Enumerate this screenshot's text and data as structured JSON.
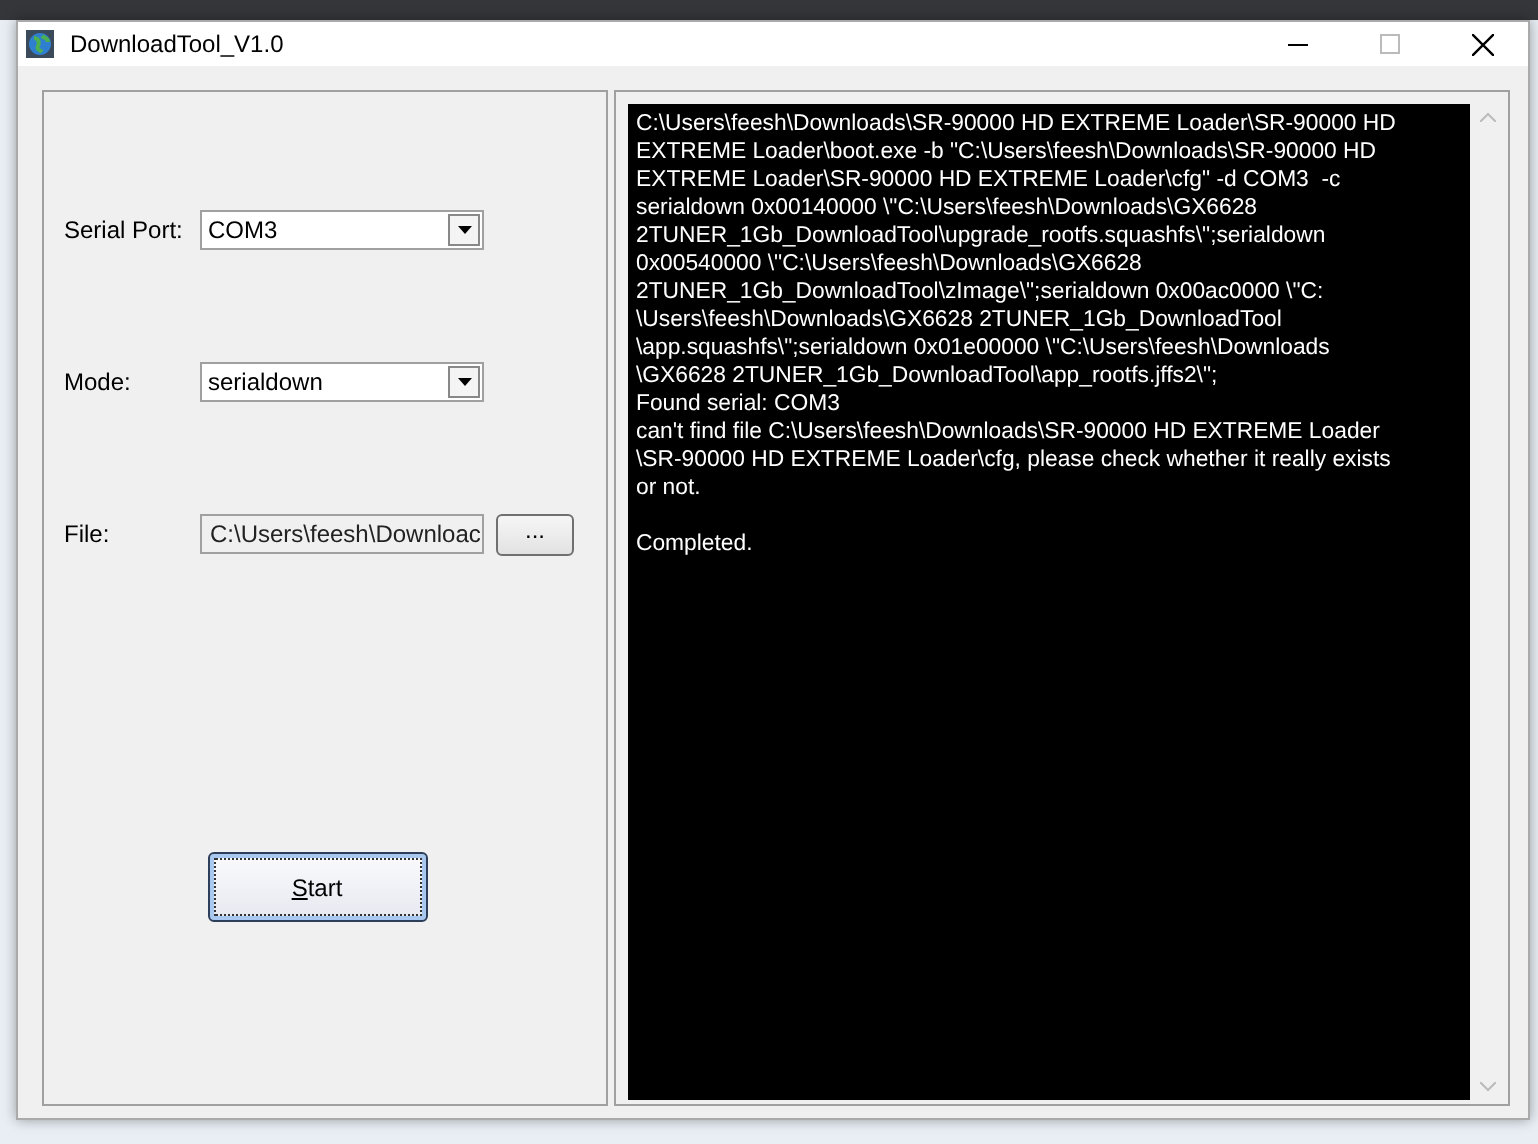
{
  "window": {
    "title": "DownloadTool_V1.0"
  },
  "form": {
    "fields": [
      {
        "kind": "combo",
        "label": "Serial Port:",
        "value": "COM3"
      },
      {
        "kind": "combo",
        "label": "Mode:",
        "value": "serialdown"
      },
      {
        "kind": "file",
        "label": "File:",
        "value": "C:\\Users\\feesh\\Downloac",
        "browse": "..."
      }
    ],
    "start_button": {
      "label": "Start",
      "access_key_underlined": true,
      "focused": true
    }
  },
  "log": [
    {
      "lines": [
        "C:\\Users\\feesh\\Downloads\\SR-90000 HD EXTREME Loader\\SR-90000 HD",
        "EXTREME Loader\\boot.exe -b \"C:\\Users\\feesh\\Downloads\\SR-90000 HD",
        "EXTREME Loader\\SR-90000 HD EXTREME Loader\\cfg\" -d COM3  -c",
        "serialdown 0x00140000 \\\"C:\\Users\\feesh\\Downloads\\GX6628",
        "2TUNER_1Gb_DownloadTool\\upgrade_rootfs.squashfs\\\";serialdown",
        "0x00540000 \\\"C:\\Users\\feesh\\Downloads\\GX6628",
        "2TUNER_1Gb_DownloadTool\\zImage\\\";serialdown 0x00ac0000 \\\"C:",
        "\\Users\\feesh\\Downloads\\GX6628 2TUNER_1Gb_DownloadTool",
        "\\app.squashfs\\\";serialdown 0x01e00000 \\\"C:\\Users\\feesh\\Downloads",
        "\\GX6628 2TUNER_1Gb_DownloadTool\\app_rootfs.jffs2\\\";",
        "Found serial: COM3",
        "can't find file C:\\Users\\feesh\\Downloads\\SR-90000 HD EXTREME Loader",
        "\\SR-90000 HD EXTREME Loader\\cfg, please check whether it really exists",
        "or not."
      ]
    },
    {
      "lines": [
        "Completed."
      ]
    }
  ]
}
